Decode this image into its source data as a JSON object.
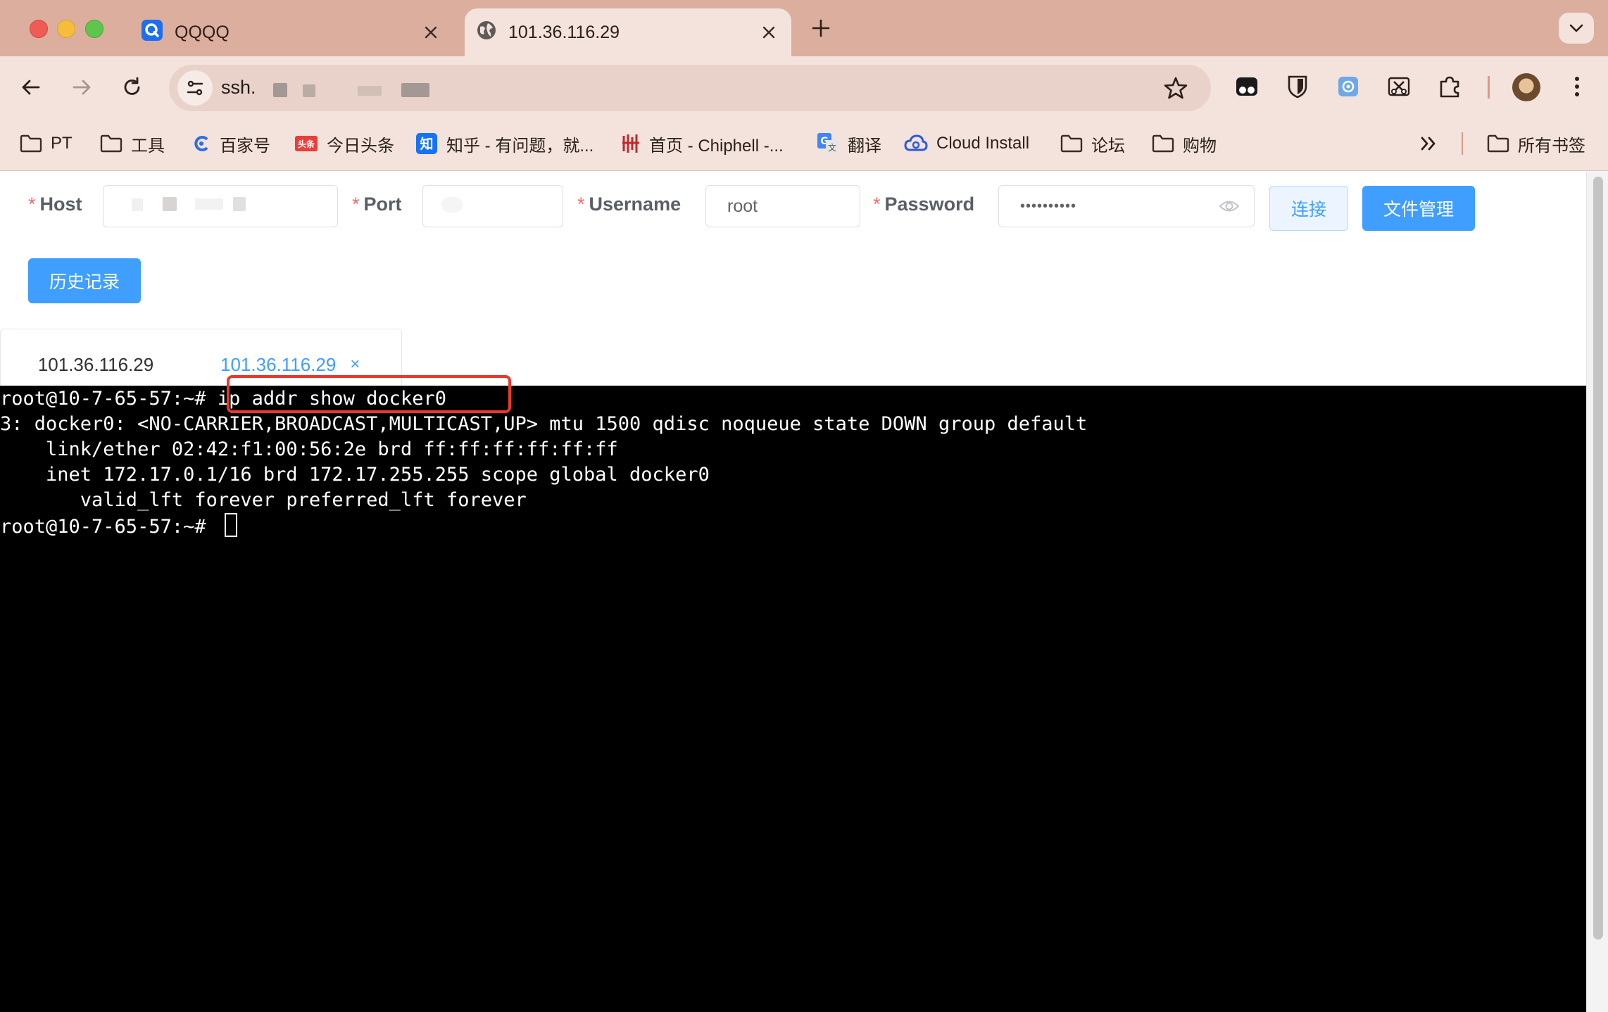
{
  "browser": {
    "tabs": [
      {
        "title": "QQQQ",
        "icon": "qqqq-favicon-icon",
        "active": false
      },
      {
        "title": "101.36.116.29",
        "icon": "globe-icon",
        "active": true
      }
    ],
    "address": {
      "text": "ssh."
    },
    "bookmarks": [
      {
        "label": "PT",
        "icon": "folder-icon"
      },
      {
        "label": "工具",
        "icon": "folder-icon"
      },
      {
        "label": "百家号",
        "icon": "baijiahao-icon"
      },
      {
        "label": "今日头条",
        "icon": "toutiao-icon"
      },
      {
        "label": "知乎 - 有问题，就...",
        "icon": "zhihu-icon"
      },
      {
        "label": "首页 - Chiphell -...",
        "icon": "chiphell-icon"
      },
      {
        "label": "翻译",
        "icon": "translate-icon"
      },
      {
        "label": "Cloud Install",
        "icon": "cloud-icon"
      },
      {
        "label": "论坛",
        "icon": "folder-icon"
      },
      {
        "label": "购物",
        "icon": "folder-icon"
      }
    ],
    "all_bookmarks": "所有书签"
  },
  "form": {
    "host_label": "Host",
    "port_label": "Port",
    "username_label": "Username",
    "username_value": "root",
    "password_label": "Password",
    "password_value": "••••••••••",
    "required_mark": "*",
    "connect_button": "连接",
    "file_manager_button": "文件管理",
    "history_button": "历史记录"
  },
  "session_tabs": [
    {
      "label": "101.36.116.29",
      "closable": false
    },
    {
      "label": "101.36.116.29",
      "closable": true,
      "close_glyph": "×"
    }
  ],
  "terminal": {
    "lines": [
      "root@10-7-65-57:~# ip addr show docker0",
      "3: docker0: <NO-CARRIER,BROADCAST,MULTICAST,UP> mtu 1500 qdisc noqueue state DOWN group default",
      "    link/ether 02:42:f1:00:56:2e brd ff:ff:ff:ff:ff:ff",
      "    inet 172.17.0.1/16 brd 172.17.255.255 scope global docker0",
      "       valid_lft forever preferred_lft forever",
      "root@10-7-65-57:~# "
    ],
    "highlight_color": "#e8392c"
  },
  "colors": {
    "tabstrip": "#dcae9e",
    "toolbar": "#f3e3dc",
    "primary": "#409eff",
    "required": "#f56c6c"
  }
}
